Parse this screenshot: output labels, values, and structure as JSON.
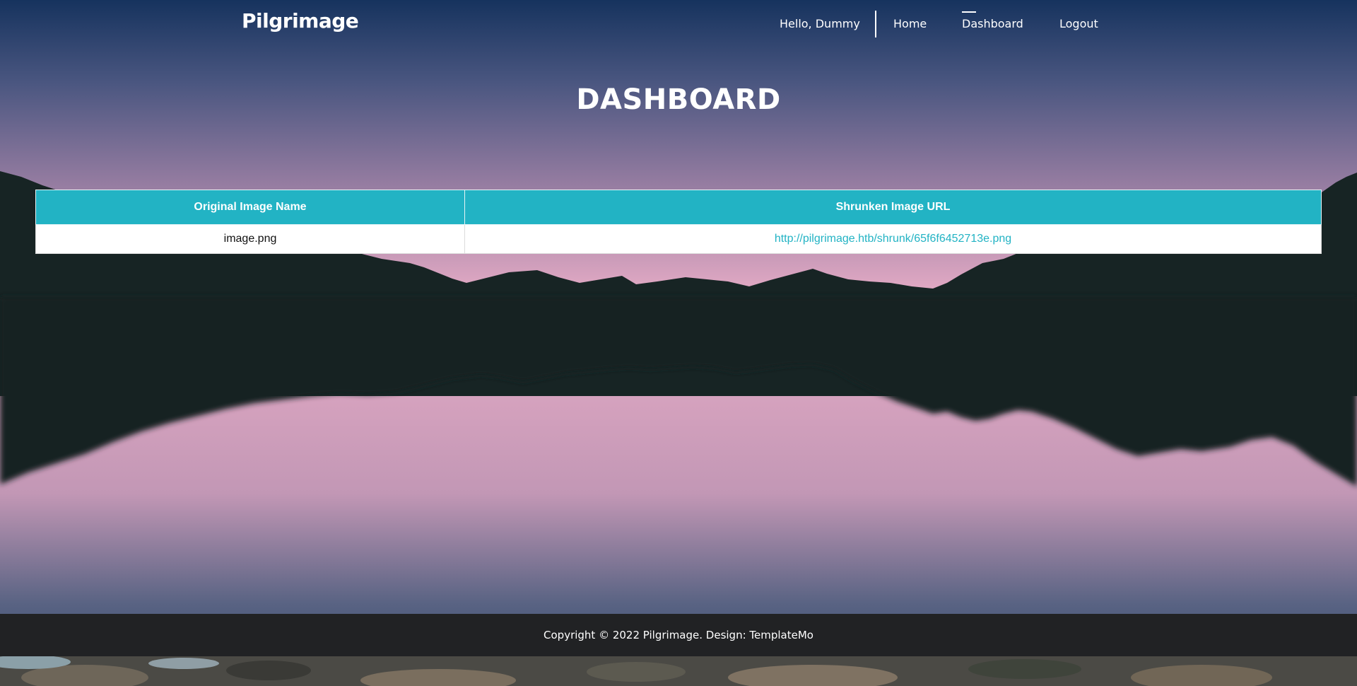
{
  "nav": {
    "brand": "Pilgrimage",
    "greeting": "Hello, Dummy",
    "home": "Home",
    "dashboard": "Dashboard",
    "logout": "Logout"
  },
  "page": {
    "title": "DASHBOARD"
  },
  "table": {
    "headers": [
      "Original Image Name",
      "Shrunken Image URL"
    ],
    "rows": [
      [
        "image.png",
        "http://pilgrimage.htb/shrunk/65f6f6452713e.png"
      ]
    ]
  },
  "footer": {
    "text": "Copyright © 2022 Pilgrimage. Design: ",
    "link": "TemplateMo"
  },
  "colors": {
    "accent": "#22b3c4",
    "footer_bg": "#212224",
    "sky_top": "#1b345f",
    "sky_pink": "#d9a4bf",
    "mountain": "#172424"
  }
}
